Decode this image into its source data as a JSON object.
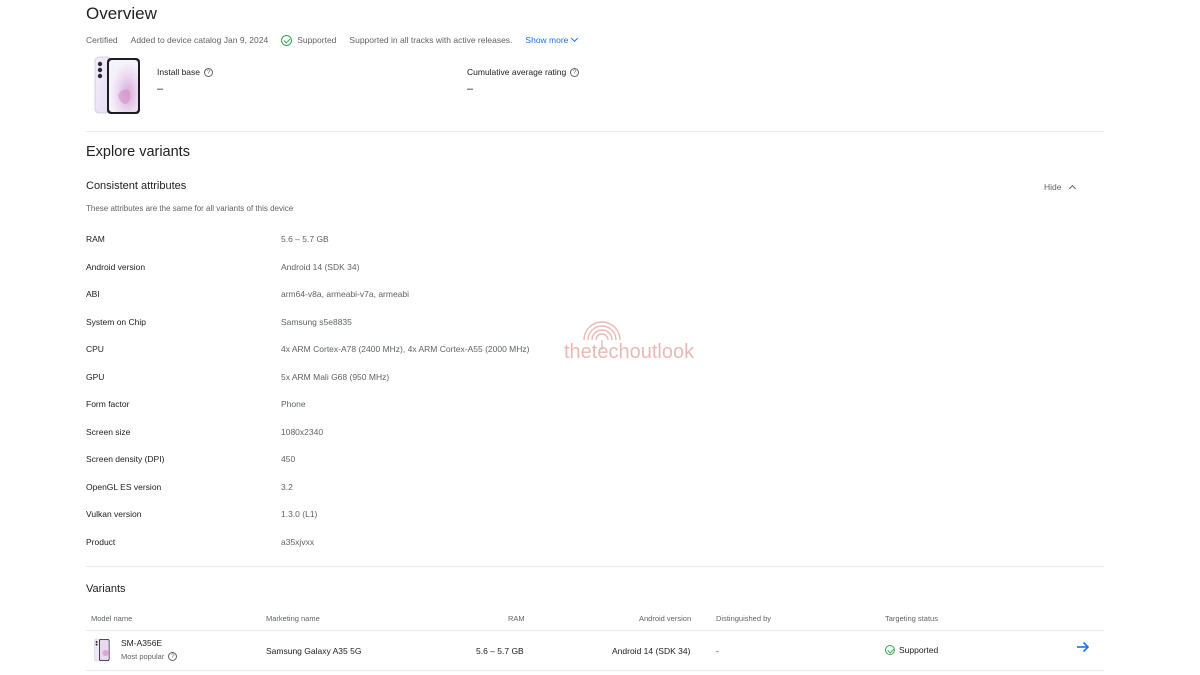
{
  "overview": {
    "title": "Overview",
    "status": "Certified",
    "added": "Added to device catalog Jan 9, 2024",
    "support": "Supported",
    "tracks": "Supported in all tracks with active releases.",
    "show_more": "Show more",
    "install_base_label": "Install base",
    "install_base_value": "–",
    "rating_label": "Cumulative average rating",
    "rating_value": "–"
  },
  "explore": {
    "title": "Explore variants",
    "consistent_title": "Consistent attributes",
    "hide_label": "Hide",
    "subtitle": "These attributes are the same for all variants of this device",
    "attributes": [
      {
        "key": "RAM",
        "value": "5.6 – 5.7 GB"
      },
      {
        "key": "Android version",
        "value": "Android 14 (SDK 34)"
      },
      {
        "key": "ABI",
        "value": "arm64-v8a, armeabi-v7a, armeabi"
      },
      {
        "key": "System on Chip",
        "value": "Samsung s5e8835"
      },
      {
        "key": "CPU",
        "value": "4x ARM Cortex-A78 (2400 MHz), 4x ARM Cortex-A55 (2000 MHz)"
      },
      {
        "key": "GPU",
        "value": "5x ARM Mali G68 (950 MHz)"
      },
      {
        "key": "Form factor",
        "value": "Phone"
      },
      {
        "key": "Screen size",
        "value": "1080x2340"
      },
      {
        "key": "Screen density (DPI)",
        "value": "450"
      },
      {
        "key": "OpenGL ES version",
        "value": "3.2"
      },
      {
        "key": "Vulkan version",
        "value": "1.3.0 (L1)"
      },
      {
        "key": "Product",
        "value": "a35xjvxx"
      }
    ]
  },
  "variants": {
    "title": "Variants",
    "headers": {
      "model": "Model name",
      "marketing": "Marketing name",
      "ram": "RAM",
      "android": "Android version",
      "distinguished": "Distinguished by",
      "targeting": "Targeting status"
    },
    "rows": [
      {
        "model": "SM-A356E",
        "popular": "Most popular",
        "marketing": "Samsung Galaxy A35 5G",
        "ram": "5.6 – 5.7 GB",
        "android": "Android 14 (SDK 34)",
        "distinguished": "-",
        "targeting": "Supported"
      }
    ]
  },
  "watermark": "thetechoutlook",
  "colors": {
    "accent": "#1a73e8",
    "success": "#34a853",
    "text": "#202124",
    "secondary": "#5f6368",
    "divider": "#e8eaed"
  },
  "icons": {
    "help": "help-circle-icon",
    "check": "check-circle-icon",
    "show_more": "chevron-down-icon",
    "hide": "chevron-up-icon",
    "row_action": "arrow-right-icon"
  }
}
